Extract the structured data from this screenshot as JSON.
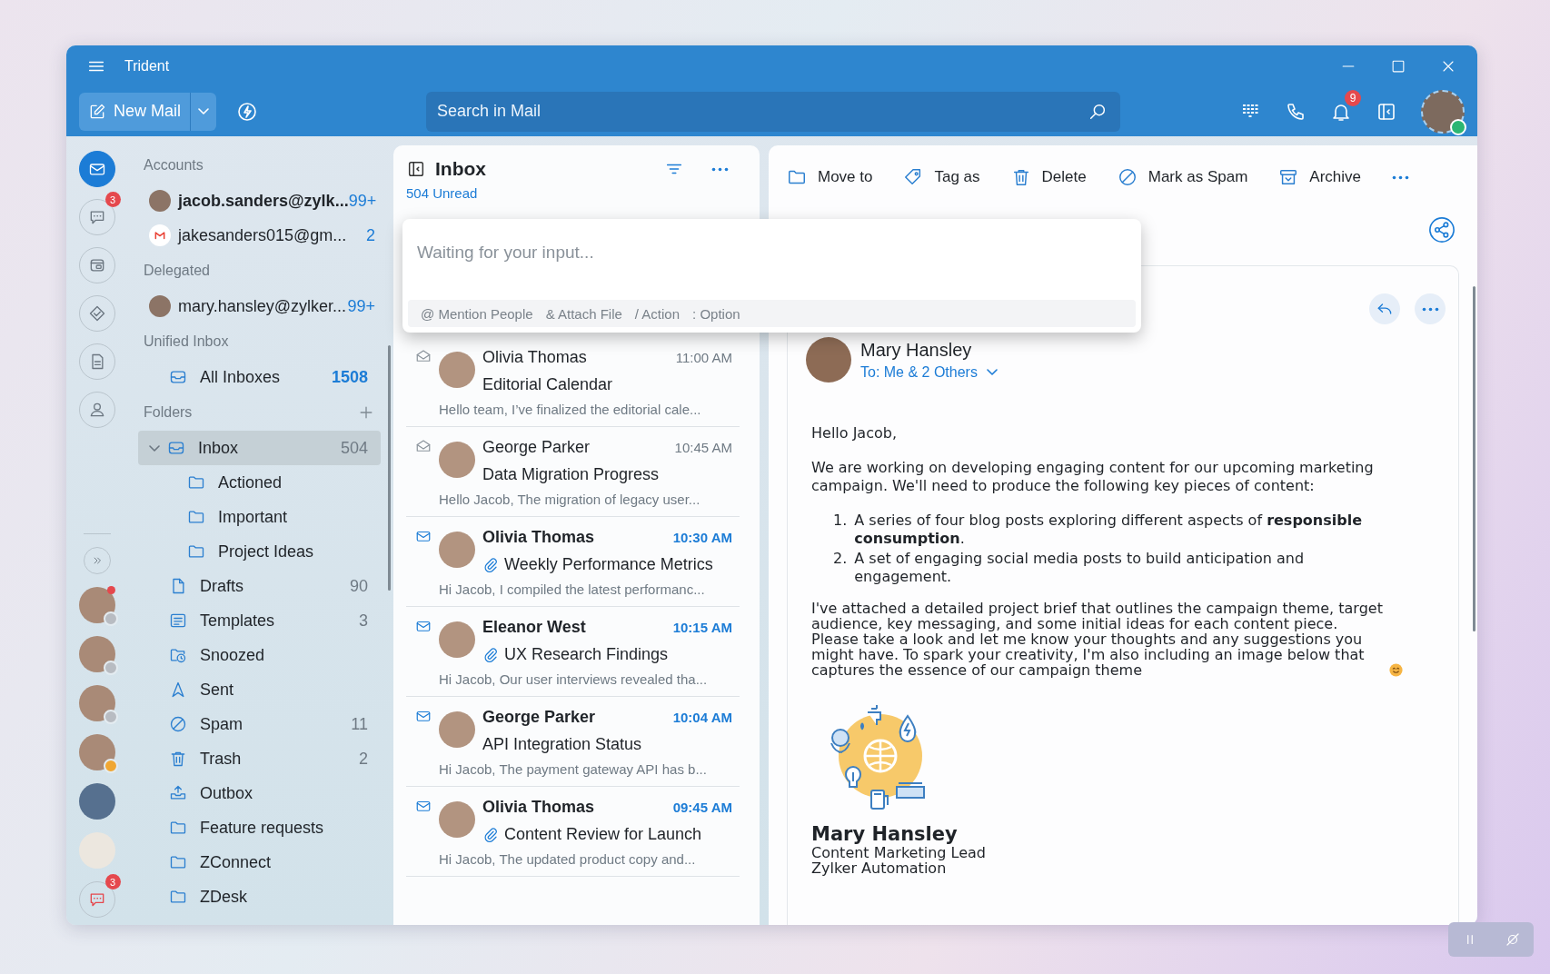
{
  "window": {
    "title": "Trident"
  },
  "header": {
    "new_mail": "New Mail",
    "search_placeholder": "Search in Mail",
    "notification_count": "9",
    "presence": {
      "color": "#2bb673"
    }
  },
  "rail": {
    "apps": [
      {
        "kind": "mail",
        "selected": true
      },
      {
        "kind": "chat",
        "selected": false,
        "badge": "3"
      },
      {
        "kind": "wallet",
        "selected": false
      },
      {
        "kind": "tagcheck",
        "selected": false
      },
      {
        "kind": "notes",
        "selected": false
      },
      {
        "kind": "contacts",
        "selected": false
      }
    ],
    "contacts": [
      {
        "kind": "person",
        "unread": true,
        "color": "#b8bcc2"
      },
      {
        "kind": "person",
        "unread": false,
        "color": "#b8bcc2"
      },
      {
        "kind": "person",
        "unread": false,
        "color": "#b8bcc2"
      },
      {
        "kind": "person",
        "unread": false,
        "color": "#f0a733"
      },
      {
        "kind": "megaphone",
        "unread": false
      },
      {
        "kind": "pen",
        "unread": false
      }
    ],
    "chat_badge": "3"
  },
  "folder_pane": {
    "accounts_heading": "Accounts",
    "accounts": [
      {
        "name": "jacob.sanders@zylk...",
        "count": "99+",
        "kind": "photo",
        "current": true
      },
      {
        "name": "jakesanders015@gm...",
        "count": "2",
        "kind": "mlogo",
        "current": false
      }
    ],
    "delegated_heading": "Delegated",
    "delegated": [
      {
        "name": "mary.hansley@zylker...",
        "count": "99+",
        "kind": "photo",
        "current": false
      }
    ],
    "unified_heading": "Unified Inbox",
    "unified": {
      "label": "All Inboxes",
      "count": "1508"
    },
    "folders_heading": "Folders",
    "folders": [
      {
        "label": "Inbox",
        "count": "504",
        "kind": "inbox",
        "selected": true,
        "expanded": true,
        "children": [
          {
            "label": "Actioned",
            "kind": "folder",
            "selected": false
          },
          {
            "label": "Important",
            "kind": "folder",
            "selected": false
          },
          {
            "label": "Project Ideas",
            "kind": "folder",
            "selected": false
          }
        ]
      },
      {
        "label": "Drafts",
        "count": "90",
        "kind": "drafts",
        "selected": false
      },
      {
        "label": "Templates",
        "count": "3",
        "kind": "templates",
        "selected": false
      },
      {
        "label": "Snoozed",
        "kind": "snoozed",
        "selected": false
      },
      {
        "label": "Sent",
        "kind": "sent",
        "selected": false
      },
      {
        "label": "Spam",
        "count": "11",
        "kind": "spam",
        "selected": false
      },
      {
        "label": "Trash",
        "count": "2",
        "kind": "trash",
        "selected": false
      },
      {
        "label": "Outbox",
        "kind": "outbox",
        "selected": false
      },
      {
        "label": "Feature requests",
        "kind": "folder",
        "selected": false
      },
      {
        "label": "ZConnect",
        "kind": "folder",
        "selected": false
      },
      {
        "label": "ZDesk",
        "kind": "folder",
        "selected": false
      }
    ]
  },
  "mail_list": {
    "title": "Inbox",
    "unread_count": "504 Unread",
    "messages": [
      {
        "sender": "Olivia Thomas",
        "time": "11:00 AM",
        "subject": "Editorial Calendar",
        "preview": "Hello team, I’ve finalized the editorial cale...",
        "unread": false,
        "attachment": false
      },
      {
        "sender": "George Parker",
        "time": "10:45 AM",
        "subject": "Data Migration Progress",
        "preview": "Hello Jacob, The migration of legacy user...",
        "unread": false,
        "attachment": false
      },
      {
        "sender": "Olivia Thomas",
        "time": "10:30 AM",
        "subject": "Weekly Performance Metrics",
        "preview": "Hi Jacob, I compiled the latest performanc...",
        "unread": true,
        "attachment": true
      },
      {
        "sender": "Eleanor West",
        "time": "10:15 AM",
        "subject": "UX Research Findings",
        "preview": "Hi Jacob, Our user interviews revealed tha...",
        "unread": true,
        "attachment": true
      },
      {
        "sender": "George Parker",
        "time": "10:04 AM",
        "subject": "API Integration Status",
        "preview": "Hi Jacob, The payment gateway API has b...",
        "unread": true,
        "attachment": false
      },
      {
        "sender": "Olivia Thomas",
        "time": "09:45 AM",
        "subject": "Content Review for Launch",
        "preview": "Hi Jacob, The updated product copy and...",
        "unread": true,
        "attachment": true
      }
    ]
  },
  "composer": {
    "placeholder": "Waiting for your input...",
    "hints": [
      "@ Mention People",
      "& Attach File",
      "/ Action",
      ": Option"
    ]
  },
  "reading_pane": {
    "actions": [
      {
        "kind": "move",
        "label": "Move to"
      },
      {
        "kind": "tag",
        "label": "Tag as"
      },
      {
        "kind": "delete",
        "label": "Delete"
      },
      {
        "kind": "spam",
        "label": "Mark as Spam"
      },
      {
        "kind": "archive",
        "label": "Archive"
      }
    ],
    "message": {
      "sender": "Mary Hansley",
      "recipients": "To: Me & 2 Others",
      "greeting": "Hello Jacob,",
      "intro": "We are working on developing engaging content for our upcoming marketing campaign. We'll need to produce the following key pieces of content:",
      "list": [
        {
          "number": "1.",
          "text": "A series of four blog posts exploring different aspects of **responsible consumption**."
        },
        {
          "number": "2.",
          "text": "A set of engaging social media posts to build anticipation and engagement."
        }
      ],
      "closing": "I've attached a detailed project brief that outlines the campaign theme, target audience, key messaging, and some initial ideas for each content piece. Please take a look and let me know your thoughts and any suggestions you might have. To spark your creativity, I'm also including an image below that captures the essence of our campaign theme",
      "signature": {
        "name": "Mary Hansley",
        "title": "Content Marketing Lead",
        "company": "Zylker Automation"
      }
    }
  }
}
